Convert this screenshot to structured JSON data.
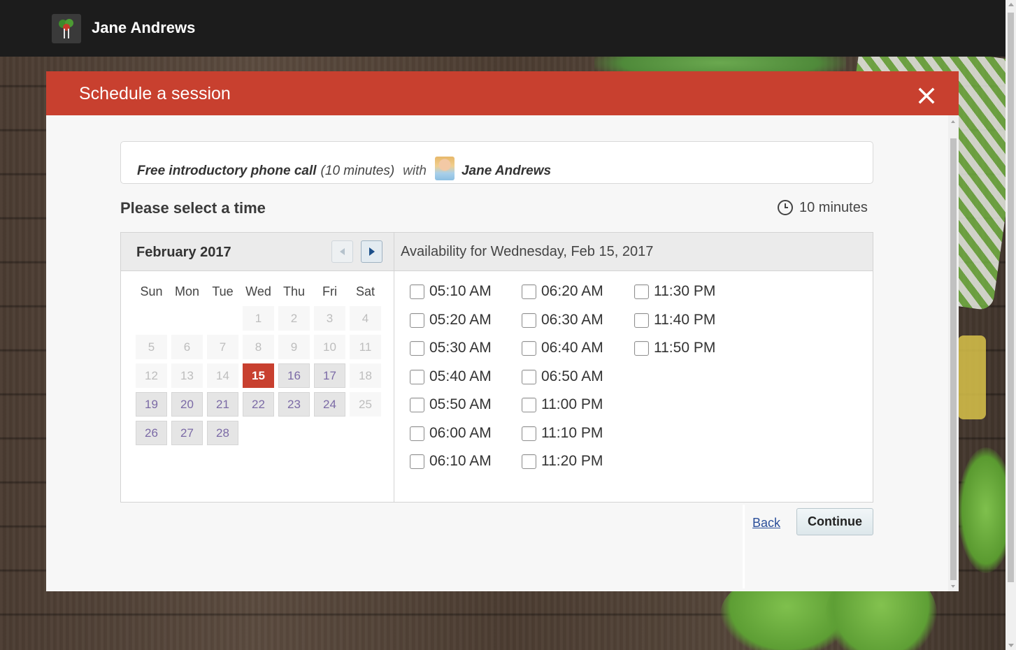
{
  "header": {
    "brand_name": "Jane Andrews",
    "logo_icon": "vegetable-logo-icon"
  },
  "modal": {
    "title": "Schedule a session",
    "close_icon": "close-icon",
    "accent_color": "#c8402f"
  },
  "service": {
    "name": "Free introductory phone call",
    "duration_text": "(10 minutes)",
    "with_text": "with",
    "provider": "Jane Andrews"
  },
  "time_selection": {
    "title": "Please select a time",
    "duration": "10 minutes"
  },
  "calendar": {
    "month_label": "February 2017",
    "weekdays": [
      "Sun",
      "Mon",
      "Tue",
      "Wed",
      "Thu",
      "Fri",
      "Sat"
    ],
    "weeks": [
      [
        {
          "day": "",
          "state": "empty"
        },
        {
          "day": "",
          "state": "empty"
        },
        {
          "day": "",
          "state": "empty"
        },
        {
          "day": "1",
          "state": "disabled"
        },
        {
          "day": "2",
          "state": "disabled"
        },
        {
          "day": "3",
          "state": "disabled"
        },
        {
          "day": "4",
          "state": "disabled"
        }
      ],
      [
        {
          "day": "5",
          "state": "disabled"
        },
        {
          "day": "6",
          "state": "disabled"
        },
        {
          "day": "7",
          "state": "disabled"
        },
        {
          "day": "8",
          "state": "disabled"
        },
        {
          "day": "9",
          "state": "disabled"
        },
        {
          "day": "10",
          "state": "disabled"
        },
        {
          "day": "11",
          "state": "disabled"
        }
      ],
      [
        {
          "day": "12",
          "state": "disabled"
        },
        {
          "day": "13",
          "state": "disabled"
        },
        {
          "day": "14",
          "state": "disabled"
        },
        {
          "day": "15",
          "state": "selected"
        },
        {
          "day": "16",
          "state": "avail"
        },
        {
          "day": "17",
          "state": "avail"
        },
        {
          "day": "18",
          "state": "disabled"
        }
      ],
      [
        {
          "day": "19",
          "state": "avail"
        },
        {
          "day": "20",
          "state": "avail"
        },
        {
          "day": "21",
          "state": "avail"
        },
        {
          "day": "22",
          "state": "avail"
        },
        {
          "day": "23",
          "state": "avail"
        },
        {
          "day": "24",
          "state": "avail"
        },
        {
          "day": "25",
          "state": "disabled"
        }
      ],
      [
        {
          "day": "26",
          "state": "avail"
        },
        {
          "day": "27",
          "state": "avail"
        },
        {
          "day": "28",
          "state": "avail"
        },
        {
          "day": "",
          "state": "empty"
        },
        {
          "day": "",
          "state": "empty"
        },
        {
          "day": "",
          "state": "empty"
        },
        {
          "day": "",
          "state": "empty"
        }
      ]
    ]
  },
  "availability": {
    "heading": "Availability for Wednesday, Feb 15, 2017",
    "columns": [
      [
        "05:10 AM",
        "05:20 AM",
        "05:30 AM",
        "05:40 AM",
        "05:50 AM",
        "06:00 AM",
        "06:10 AM"
      ],
      [
        "06:20 AM",
        "06:30 AM",
        "06:40 AM",
        "06:50 AM",
        "11:00 PM",
        "11:10 PM",
        "11:20 PM"
      ],
      [
        "11:30 PM",
        "11:40 PM",
        "11:50 PM"
      ]
    ]
  },
  "footer": {
    "back_label": "Back",
    "continue_label": "Continue"
  }
}
